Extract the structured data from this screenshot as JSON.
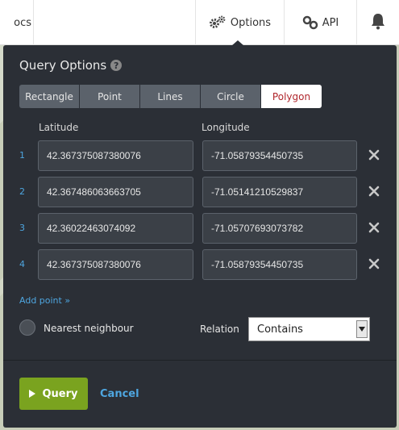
{
  "nav": {
    "docs_label": "ocs",
    "options_label": "Options",
    "api_label": "API"
  },
  "panel": {
    "title": "Query Options",
    "help_glyph": "?",
    "tabs": [
      {
        "label": "Rectangle",
        "active": false
      },
      {
        "label": "Point",
        "active": false
      },
      {
        "label": "Lines",
        "active": false
      },
      {
        "label": "Circle",
        "active": false
      },
      {
        "label": "Polygon",
        "active": true
      }
    ],
    "latitude_header": "Latitude",
    "longitude_header": "Longitude",
    "points": [
      {
        "num": "1",
        "lat": "42.367375087380076",
        "lng": "-71.05879354450735"
      },
      {
        "num": "2",
        "lat": "42.367486063663705",
        "lng": "-71.05141210529837"
      },
      {
        "num": "3",
        "lat": "42.36022463074092",
        "lng": "-71.05707693073782"
      },
      {
        "num": "4",
        "lat": "42.367375087380076",
        "lng": "-71.05879354450735"
      }
    ],
    "add_point_label": "Add point »",
    "nearest_neighbour_label": "Nearest neighbour",
    "relation_label": "Relation",
    "relation_value": "Contains",
    "query_label": "Query",
    "cancel_label": "Cancel"
  },
  "colors": {
    "panel_bg": "#2b2f36",
    "accent_blue": "#4ea6e0",
    "active_tab_text": "#b0262c",
    "query_green": "#7aa31f"
  }
}
